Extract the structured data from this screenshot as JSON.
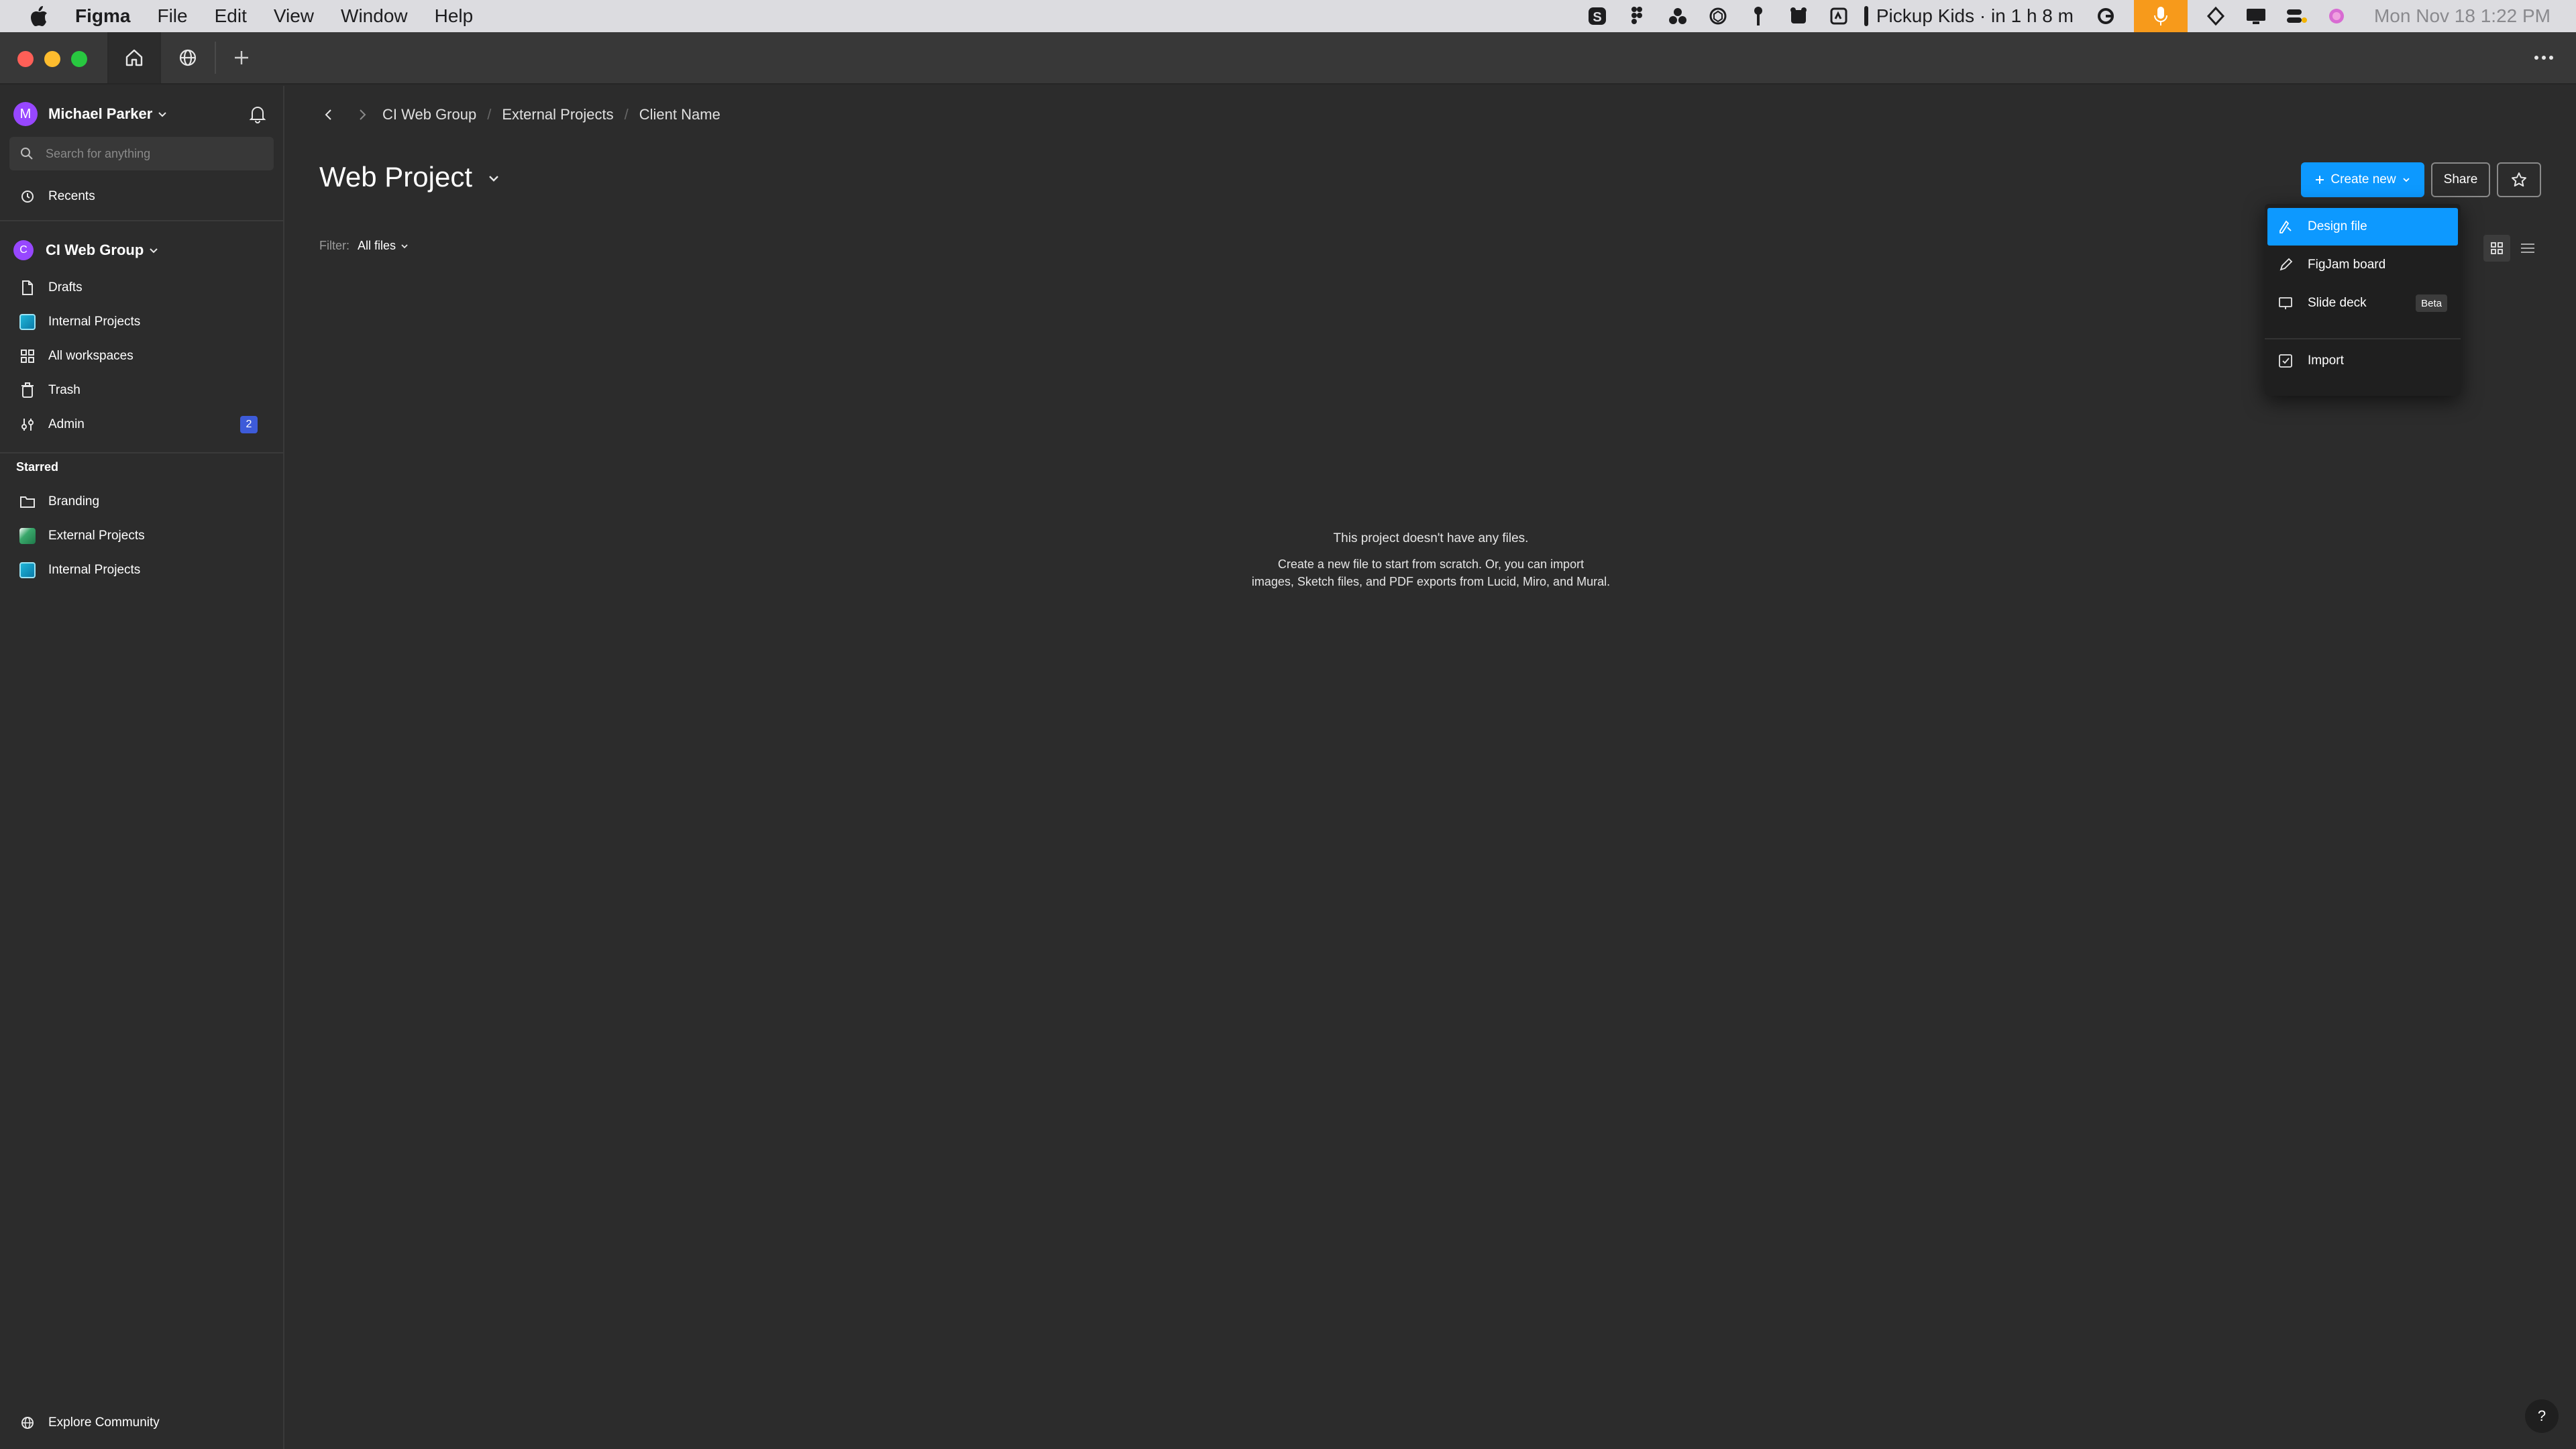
{
  "menubar": {
    "app_name": "Figma",
    "menus": [
      "File",
      "Edit",
      "View",
      "Window",
      "Help"
    ],
    "reminder": "Pickup Kids · in 1 h 8 m",
    "clock": "Mon Nov 18  1:22 PM",
    "mic_color": "#f79a1b"
  },
  "tabbar": {
    "home_icon": "home-icon",
    "community_icon": "globe-icon",
    "new_tab_icon": "plus-icon",
    "more_icon": "ellipsis-icon"
  },
  "sidebar": {
    "user": {
      "initial": "M",
      "name": "Michael Parker"
    },
    "search_placeholder": "Search for anything",
    "recents": "Recents",
    "team": {
      "initial": "C",
      "name": "CI Web Group"
    },
    "team_items": [
      {
        "label": "Drafts",
        "icon": "file-icon"
      },
      {
        "label": "Internal Projects",
        "icon": "project-icon"
      },
      {
        "label": "All workspaces",
        "icon": "grid-icon"
      },
      {
        "label": "Trash",
        "icon": "trash-icon"
      },
      {
        "label": "Admin",
        "icon": "admin-icon",
        "badge": "2"
      }
    ],
    "starred_title": "Starred",
    "starred_items": [
      {
        "label": "Branding",
        "icon": "folder-icon"
      },
      {
        "label": "External Projects",
        "icon": "project-thumbnail-icon"
      },
      {
        "label": "Internal Projects",
        "icon": "project-icon"
      }
    ],
    "explore": "Explore Community"
  },
  "main": {
    "breadcrumb": [
      "CI Web Group",
      "External Projects",
      "Client Name"
    ],
    "title": "Web Project",
    "filter_label": "Filter:",
    "filter_value": "All files",
    "create_new": "Create new",
    "share": "Share",
    "empty_title": "This project doesn't have any files.",
    "empty_line1": "Create a new file to start from scratch. Or, you can import",
    "empty_line2": "images, Sketch files, and PDF exports from Lucid, Miro, and Mural."
  },
  "dropdown": {
    "items": [
      {
        "label": "Design file",
        "icon": "design-file-icon",
        "active": true
      },
      {
        "label": "FigJam board",
        "icon": "pen-icon"
      },
      {
        "label": "Slide deck",
        "icon": "slide-deck-icon",
        "badge": "Beta"
      },
      {
        "label": "Import",
        "icon": "import-icon"
      }
    ]
  },
  "help": "?",
  "colors": {
    "accent": "#0d99ff",
    "team_purple": "#9747ff",
    "badge_blue": "#3d5bd9"
  }
}
